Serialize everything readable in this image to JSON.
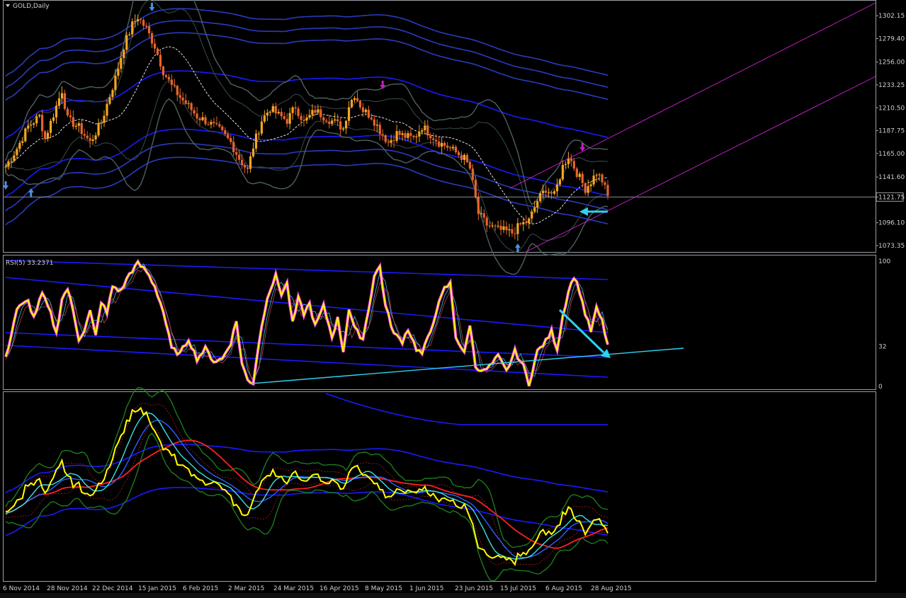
{
  "window": {
    "symbol_title": "GOLD,Daily",
    "rsi_label": "RSI(5) 33.2371"
  },
  "colors": {
    "background": "#000000",
    "bull_candle": "#f5a623",
    "bear_candle": "#e8642a",
    "ma_blue": "#1a1aff",
    "ma_dark_blue": "#2a3bbd",
    "band_gray": "#4f6060",
    "dash_white": "#e8e8e8",
    "channel_magenta": "#d020d0",
    "cyan_arrow": "#30d0f0",
    "rsi_yellow": "#ffff00",
    "rsi_magenta": "#ff40ff",
    "ind_red": "#ff2020",
    "ind_green": "#1e7a1e",
    "ind_cyan": "#40e0e0",
    "price_line": "#9aa0a6"
  },
  "chart_data": [
    {
      "type": "candlestick",
      "title": "GOLD,Daily",
      "price_axis_ticks": [
        "1302.15",
        "1279.40",
        "1256.00",
        "1233.25",
        "1210.50",
        "1187.75",
        "1165.00",
        "1141.60",
        "1121.75",
        "1096.10",
        "1073.35"
      ],
      "current_price": "1121.75",
      "ylim": [
        1067,
        1315
      ],
      "x_tick_labels": [
        "6 Nov 2014",
        "28 Nov 2014",
        "22 Dec 2014",
        "15 Jan 2015",
        "6 Feb 2015",
        "2 Mar 2015",
        "24 Mar 2015",
        "16 Apr 2015",
        "8 May 2015",
        "1 Jun 2015",
        "23 Jun 2015",
        "15 Jul 2015",
        "6 Aug 2015",
        "28 Aug 2015"
      ],
      "close_path": [
        [
          0,
          1152
        ],
        [
          4,
          1170
        ],
        [
          8,
          1192
        ],
        [
          12,
          1202
        ],
        [
          14,
          1180
        ],
        [
          18,
          1212
        ],
        [
          20,
          1228
        ],
        [
          22,
          1199
        ],
        [
          26,
          1191
        ],
        [
          30,
          1176
        ],
        [
          34,
          1196
        ],
        [
          36,
          1214
        ],
        [
          39,
          1240
        ],
        [
          42,
          1272
        ],
        [
          45,
          1293
        ],
        [
          47,
          1301
        ],
        [
          50,
          1289
        ],
        [
          53,
          1272
        ],
        [
          56,
          1247
        ],
        [
          59,
          1232
        ],
        [
          62,
          1221
        ],
        [
          65,
          1212
        ],
        [
          68,
          1202
        ],
        [
          72,
          1196
        ],
        [
          76,
          1188
        ],
        [
          80,
          1176
        ],
        [
          83,
          1160
        ],
        [
          86,
          1148
        ],
        [
          88,
          1172
        ],
        [
          91,
          1198
        ],
        [
          94,
          1210
        ],
        [
          97,
          1203
        ],
        [
          100,
          1198
        ],
        [
          103,
          1212
        ],
        [
          106,
          1196
        ],
        [
          110,
          1208
        ],
        [
          113,
          1202
        ],
        [
          117,
          1196
        ],
        [
          120,
          1190
        ],
        [
          122,
          1213
        ],
        [
          124,
          1224
        ],
        [
          127,
          1208
        ],
        [
          130,
          1202
        ],
        [
          133,
          1188
        ],
        [
          136,
          1176
        ],
        [
          139,
          1185
        ],
        [
          142,
          1182
        ],
        [
          145,
          1180
        ],
        [
          148,
          1192
        ],
        [
          151,
          1184
        ],
        [
          154,
          1176
        ],
        [
          157,
          1172
        ],
        [
          160,
          1166
        ],
        [
          163,
          1160
        ],
        [
          165,
          1150
        ],
        [
          168,
          1105
        ],
        [
          171,
          1094
        ],
        [
          174,
          1090
        ],
        [
          177,
          1088
        ],
        [
          180,
          1086
        ],
        [
          183,
          1094
        ],
        [
          186,
          1098
        ],
        [
          189,
          1118
        ],
        [
          192,
          1130
        ],
        [
          195,
          1123
        ],
        [
          198,
          1152
        ],
        [
          200,
          1163
        ],
        [
          203,
          1146
        ],
        [
          206,
          1130
        ],
        [
          208,
          1137
        ],
        [
          210,
          1146
        ],
        [
          212,
          1138
        ],
        [
          214,
          1122
        ]
      ],
      "markers": [
        {
          "type": "arrow-down",
          "x": 0,
          "color": "#4a90e2"
        },
        {
          "type": "arrow-up",
          "x": 9,
          "color": "#4a90e2"
        },
        {
          "type": "arrow-down",
          "x": 52,
          "color": "#4a90e2"
        },
        {
          "type": "arrow-down",
          "x": 134,
          "color": "#c020c0"
        },
        {
          "type": "arrow-up",
          "x": 182,
          "color": "#4a90e2"
        },
        {
          "type": "arrow-down",
          "x": 205,
          "color": "#c020c0"
        }
      ]
    },
    {
      "type": "line",
      "title": "RSI(5) 33.2371",
      "ylim": [
        0,
        100
      ],
      "y_ticks": [
        "100",
        "32",
        "0"
      ],
      "rsi_path": [
        [
          0,
          22
        ],
        [
          4,
          62
        ],
        [
          8,
          68
        ],
        [
          10,
          55
        ],
        [
          13,
          74
        ],
        [
          16,
          58
        ],
        [
          18,
          42
        ],
        [
          20,
          70
        ],
        [
          22,
          78
        ],
        [
          24,
          60
        ],
        [
          26,
          38
        ],
        [
          28,
          45
        ],
        [
          30,
          60
        ],
        [
          32,
          40
        ],
        [
          34,
          68
        ],
        [
          36,
          58
        ],
        [
          38,
          80
        ],
        [
          41,
          76
        ],
        [
          44,
          90
        ],
        [
          47,
          98
        ],
        [
          50,
          92
        ],
        [
          53,
          80
        ],
        [
          56,
          60
        ],
        [
          59,
          30
        ],
        [
          62,
          26
        ],
        [
          65,
          38
        ],
        [
          68,
          22
        ],
        [
          71,
          30
        ],
        [
          74,
          20
        ],
        [
          77,
          22
        ],
        [
          80,
          35
        ],
        [
          82,
          52
        ],
        [
          84,
          18
        ],
        [
          86,
          5
        ],
        [
          88,
          3
        ],
        [
          90,
          35
        ],
        [
          93,
          72
        ],
        [
          96,
          88
        ],
        [
          98,
          74
        ],
        [
          100,
          82
        ],
        [
          102,
          50
        ],
        [
          104,
          70
        ],
        [
          106,
          58
        ],
        [
          108,
          66
        ],
        [
          110,
          48
        ],
        [
          113,
          64
        ],
        [
          116,
          40
        ],
        [
          118,
          54
        ],
        [
          120,
          28
        ],
        [
          122,
          62
        ],
        [
          124,
          46
        ],
        [
          127,
          38
        ],
        [
          129,
          62
        ],
        [
          131,
          88
        ],
        [
          133,
          96
        ],
        [
          135,
          64
        ],
        [
          138,
          42
        ],
        [
          141,
          36
        ],
        [
          143,
          46
        ],
        [
          146,
          30
        ],
        [
          148,
          26
        ],
        [
          151,
          44
        ],
        [
          153,
          60
        ],
        [
          156,
          78
        ],
        [
          158,
          82
        ],
        [
          160,
          40
        ],
        [
          163,
          26
        ],
        [
          165,
          50
        ],
        [
          167,
          16
        ],
        [
          170,
          12
        ],
        [
          173,
          18
        ],
        [
          175,
          24
        ],
        [
          178,
          12
        ],
        [
          181,
          28
        ],
        [
          184,
          16
        ],
        [
          186,
          2
        ],
        [
          189,
          28
        ],
        [
          192,
          36
        ],
        [
          194,
          44
        ],
        [
          196,
          30
        ],
        [
          198,
          56
        ],
        [
          200,
          76
        ],
        [
          202,
          88
        ],
        [
          204,
          76
        ],
        [
          206,
          58
        ],
        [
          208,
          44
        ],
        [
          210,
          62
        ],
        [
          212,
          52
        ],
        [
          214,
          33
        ]
      ],
      "markers": []
    }
  ]
}
